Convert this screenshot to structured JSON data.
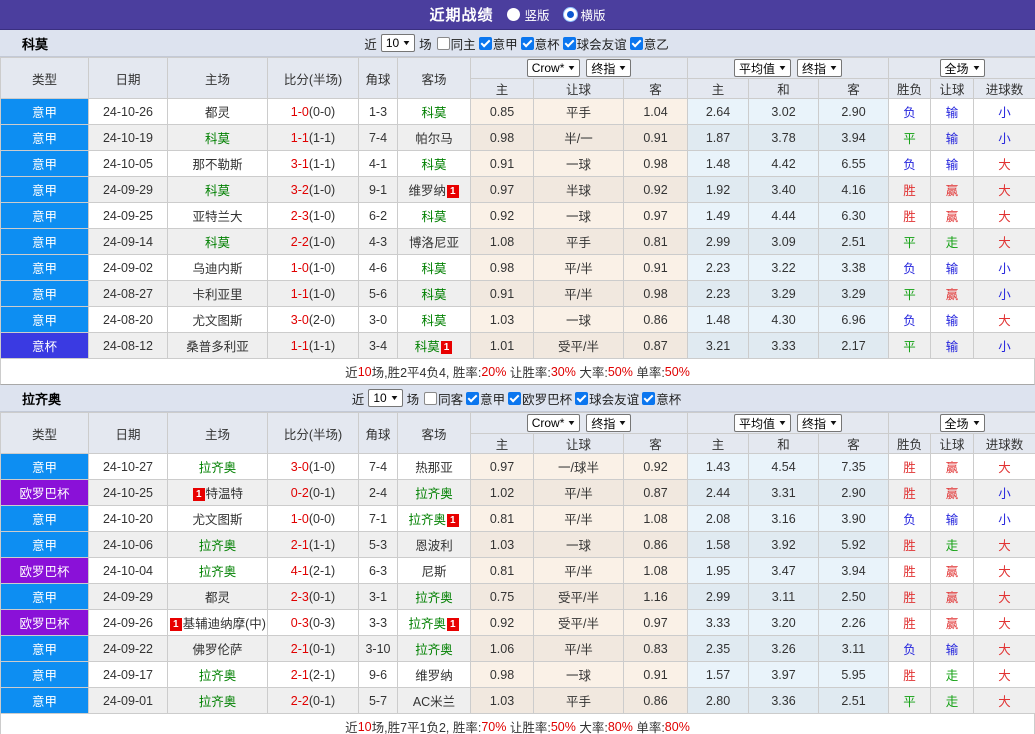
{
  "header": {
    "title": "近期战绩",
    "radio_vertical": "竖版",
    "radio_horizontal": "横版"
  },
  "shared": {
    "near_label": "近",
    "games_label": "场",
    "cols": [
      "类型",
      "日期",
      "主场",
      "比分(半场)",
      "角球",
      "客场"
    ],
    "group1_select1": "Crow*",
    "group1_select2": "终指",
    "group1_sub": [
      "主",
      "让球",
      "客"
    ],
    "group2_select1": "平均值",
    "group2_select2": "终指",
    "group2_sub": [
      "主",
      "和",
      "客"
    ],
    "group3_select": "全场",
    "group3_sub": [
      "胜负",
      "让球",
      "进球数"
    ]
  },
  "colors": {
    "league": {
      "意甲": "#0d8ef2",
      "意杯": "#3a3ae2",
      "欧罗巴杯": "#8a11d8"
    },
    "accent_purple": "#4b3e9e",
    "team_highlight": "#008000",
    "score_red": "#e00000",
    "win_red": "#e13333",
    "draw_green": "#12a012",
    "loss_blue": "#2525dd"
  },
  "sections": [
    {
      "team": "科莫",
      "rounds": "10",
      "same_venue_label": "同主",
      "leagues": [
        "意甲",
        "意杯",
        "球会友谊",
        "意乙"
      ],
      "rows": [
        {
          "league": "意甲",
          "date": "24-10-26",
          "home": "都灵",
          "away": "科莫",
          "away_hl": true,
          "score": "1-0",
          "half": "(0-0)",
          "corner": "1-3",
          "o1": [
            "0.85",
            "平手",
            "1.04"
          ],
          "o2": [
            "2.64",
            "3.02",
            "2.90"
          ],
          "res": [
            "负",
            "输",
            "小"
          ]
        },
        {
          "league": "意甲",
          "date": "24-10-19",
          "home": "科莫",
          "home_hl": true,
          "away": "帕尔马",
          "score": "1-1",
          "half": "(1-1)",
          "corner": "7-4",
          "o1": [
            "0.98",
            "半/一",
            "0.91"
          ],
          "o2": [
            "1.87",
            "3.78",
            "3.94"
          ],
          "res": [
            "平",
            "输",
            "小"
          ]
        },
        {
          "league": "意甲",
          "date": "24-10-05",
          "home": "那不勒斯",
          "away": "科莫",
          "away_hl": true,
          "score": "3-1",
          "half": "(1-1)",
          "corner": "4-1",
          "o1": [
            "0.91",
            "一球",
            "0.98"
          ],
          "o2": [
            "1.48",
            "4.42",
            "6.55"
          ],
          "res": [
            "负",
            "输",
            "大"
          ]
        },
        {
          "league": "意甲",
          "date": "24-09-29",
          "home": "科莫",
          "home_hl": true,
          "away": "维罗纳",
          "away_card": "after",
          "score": "3-2",
          "half": "(1-0)",
          "corner": "9-1",
          "o1": [
            "0.97",
            "半球",
            "0.92"
          ],
          "o2": [
            "1.92",
            "3.40",
            "4.16"
          ],
          "res": [
            "胜",
            "赢",
            "大"
          ]
        },
        {
          "league": "意甲",
          "date": "24-09-25",
          "home": "亚特兰大",
          "away": "科莫",
          "away_hl": true,
          "score": "2-3",
          "half": "(1-0)",
          "corner": "6-2",
          "o1": [
            "0.92",
            "一球",
            "0.97"
          ],
          "o2": [
            "1.49",
            "4.44",
            "6.30"
          ],
          "res": [
            "胜",
            "赢",
            "大"
          ]
        },
        {
          "league": "意甲",
          "date": "24-09-14",
          "home": "科莫",
          "home_hl": true,
          "away": "博洛尼亚",
          "score": "2-2",
          "half": "(1-0)",
          "corner": "4-3",
          "o1": [
            "1.08",
            "平手",
            "0.81"
          ],
          "o2": [
            "2.99",
            "3.09",
            "2.51"
          ],
          "res": [
            "平",
            "走",
            "大"
          ]
        },
        {
          "league": "意甲",
          "date": "24-09-02",
          "home": "乌迪内斯",
          "away": "科莫",
          "away_hl": true,
          "score": "1-0",
          "half": "(1-0)",
          "corner": "4-6",
          "o1": [
            "0.98",
            "平/半",
            "0.91"
          ],
          "o2": [
            "2.23",
            "3.22",
            "3.38"
          ],
          "res": [
            "负",
            "输",
            "小"
          ]
        },
        {
          "league": "意甲",
          "date": "24-08-27",
          "home": "卡利亚里",
          "away": "科莫",
          "away_hl": true,
          "score": "1-1",
          "half": "(1-0)",
          "corner": "5-6",
          "o1": [
            "0.91",
            "平/半",
            "0.98"
          ],
          "o2": [
            "2.23",
            "3.29",
            "3.29"
          ],
          "res": [
            "平",
            "赢",
            "小"
          ]
        },
        {
          "league": "意甲",
          "date": "24-08-20",
          "home": "尤文图斯",
          "away": "科莫",
          "away_hl": true,
          "score": "3-0",
          "half": "(2-0)",
          "corner": "3-0",
          "o1": [
            "1.03",
            "一球",
            "0.86"
          ],
          "o2": [
            "1.48",
            "4.30",
            "6.96"
          ],
          "res": [
            "负",
            "输",
            "大"
          ]
        },
        {
          "league": "意杯",
          "date": "24-08-12",
          "home": "桑普多利亚",
          "away": "科莫",
          "away_hl": true,
          "away_card": "after",
          "score": "1-1",
          "half": "(1-1)",
          "corner": "3-4",
          "o1": [
            "1.01",
            "受平/半",
            "0.87"
          ],
          "o2": [
            "3.21",
            "3.33",
            "2.17"
          ],
          "res": [
            "平",
            "输",
            "小"
          ]
        }
      ],
      "summary": [
        {
          "t": "近"
        },
        {
          "t": "10",
          "red": true
        },
        {
          "t": "场,胜2平4负4, 胜率:"
        },
        {
          "t": "20%",
          "red": true
        },
        {
          "t": " 让胜率:"
        },
        {
          "t": "30%",
          "red": true
        },
        {
          "t": " 大率:"
        },
        {
          "t": "50%",
          "red": true
        },
        {
          "t": " 单率:"
        },
        {
          "t": "50%",
          "red": true
        }
      ]
    },
    {
      "team": "拉齐奥",
      "rounds": "10",
      "same_venue_label": "同客",
      "leagues": [
        "意甲",
        "欧罗巴杯",
        "球会友谊",
        "意杯"
      ],
      "rows": [
        {
          "league": "意甲",
          "date": "24-10-27",
          "home": "拉齐奥",
          "home_hl": true,
          "away": "热那亚",
          "score": "3-0",
          "half": "(1-0)",
          "corner": "7-4",
          "o1": [
            "0.97",
            "一/球半",
            "0.92"
          ],
          "o2": [
            "1.43",
            "4.54",
            "7.35"
          ],
          "res": [
            "胜",
            "赢",
            "大"
          ]
        },
        {
          "league": "欧罗巴杯",
          "date": "24-10-25",
          "home": "特温特",
          "home_card": "before",
          "away": "拉齐奥",
          "away_hl": true,
          "score": "0-2",
          "half": "(0-1)",
          "corner": "2-4",
          "o1": [
            "1.02",
            "平/半",
            "0.87"
          ],
          "o2": [
            "2.44",
            "3.31",
            "2.90"
          ],
          "res": [
            "胜",
            "赢",
            "小"
          ]
        },
        {
          "league": "意甲",
          "date": "24-10-20",
          "home": "尤文图斯",
          "away": "拉齐奥",
          "away_hl": true,
          "away_card": "after",
          "score": "1-0",
          "half": "(0-0)",
          "corner": "7-1",
          "o1": [
            "0.81",
            "平/半",
            "1.08"
          ],
          "o2": [
            "2.08",
            "3.16",
            "3.90"
          ],
          "res": [
            "负",
            "输",
            "小"
          ]
        },
        {
          "league": "意甲",
          "date": "24-10-06",
          "home": "拉齐奥",
          "home_hl": true,
          "away": "恩波利",
          "score": "2-1",
          "half": "(1-1)",
          "corner": "5-3",
          "o1": [
            "1.03",
            "一球",
            "0.86"
          ],
          "o2": [
            "1.58",
            "3.92",
            "5.92"
          ],
          "res": [
            "胜",
            "走",
            "大"
          ]
        },
        {
          "league": "欧罗巴杯",
          "date": "24-10-04",
          "home": "拉齐奥",
          "home_hl": true,
          "away": "尼斯",
          "score": "4-1",
          "half": "(2-1)",
          "corner": "6-3",
          "o1": [
            "0.81",
            "平/半",
            "1.08"
          ],
          "o2": [
            "1.95",
            "3.47",
            "3.94"
          ],
          "res": [
            "胜",
            "赢",
            "大"
          ]
        },
        {
          "league": "意甲",
          "date": "24-09-29",
          "home": "都灵",
          "away": "拉齐奥",
          "away_hl": true,
          "score": "2-3",
          "half": "(0-1)",
          "corner": "3-1",
          "o1": [
            "0.75",
            "受平/半",
            "1.16"
          ],
          "o2": [
            "2.99",
            "3.11",
            "2.50"
          ],
          "res": [
            "胜",
            "赢",
            "大"
          ]
        },
        {
          "league": "欧罗巴杯",
          "date": "24-09-26",
          "home": "基辅迪纳摩(中)",
          "home_card": "before",
          "away": "拉齐奥",
          "away_hl": true,
          "away_card": "after",
          "score": "0-3",
          "half": "(0-3)",
          "corner": "3-3",
          "o1": [
            "0.92",
            "受平/半",
            "0.97"
          ],
          "o2": [
            "3.33",
            "3.20",
            "2.26"
          ],
          "res": [
            "胜",
            "赢",
            "大"
          ]
        },
        {
          "league": "意甲",
          "date": "24-09-22",
          "home": "佛罗伦萨",
          "away": "拉齐奥",
          "away_hl": true,
          "score": "2-1",
          "half": "(0-1)",
          "corner": "3-10",
          "o1": [
            "1.06",
            "平/半",
            "0.83"
          ],
          "o2": [
            "2.35",
            "3.26",
            "3.11"
          ],
          "res": [
            "负",
            "输",
            "大"
          ]
        },
        {
          "league": "意甲",
          "date": "24-09-17",
          "home": "拉齐奥",
          "home_hl": true,
          "away": "维罗纳",
          "score": "2-1",
          "half": "(2-1)",
          "corner": "9-6",
          "o1": [
            "0.98",
            "一球",
            "0.91"
          ],
          "o2": [
            "1.57",
            "3.97",
            "5.95"
          ],
          "res": [
            "胜",
            "走",
            "大"
          ]
        },
        {
          "league": "意甲",
          "date": "24-09-01",
          "home": "拉齐奥",
          "home_hl": true,
          "away": "AC米兰",
          "score": "2-2",
          "half": "(0-1)",
          "corner": "5-7",
          "o1": [
            "1.03",
            "平手",
            "0.86"
          ],
          "o2": [
            "2.80",
            "3.36",
            "2.51"
          ],
          "res": [
            "平",
            "走",
            "大"
          ]
        }
      ],
      "summary": [
        {
          "t": "近"
        },
        {
          "t": "10",
          "red": true
        },
        {
          "t": "场,胜7平1负2, 胜率:"
        },
        {
          "t": "70%",
          "red": true
        },
        {
          "t": " 让胜率:"
        },
        {
          "t": "50%",
          "red": true
        },
        {
          "t": " 大率:"
        },
        {
          "t": "80%",
          "red": true
        },
        {
          "t": " 单率:"
        },
        {
          "t": "80%",
          "red": true
        }
      ]
    }
  ]
}
